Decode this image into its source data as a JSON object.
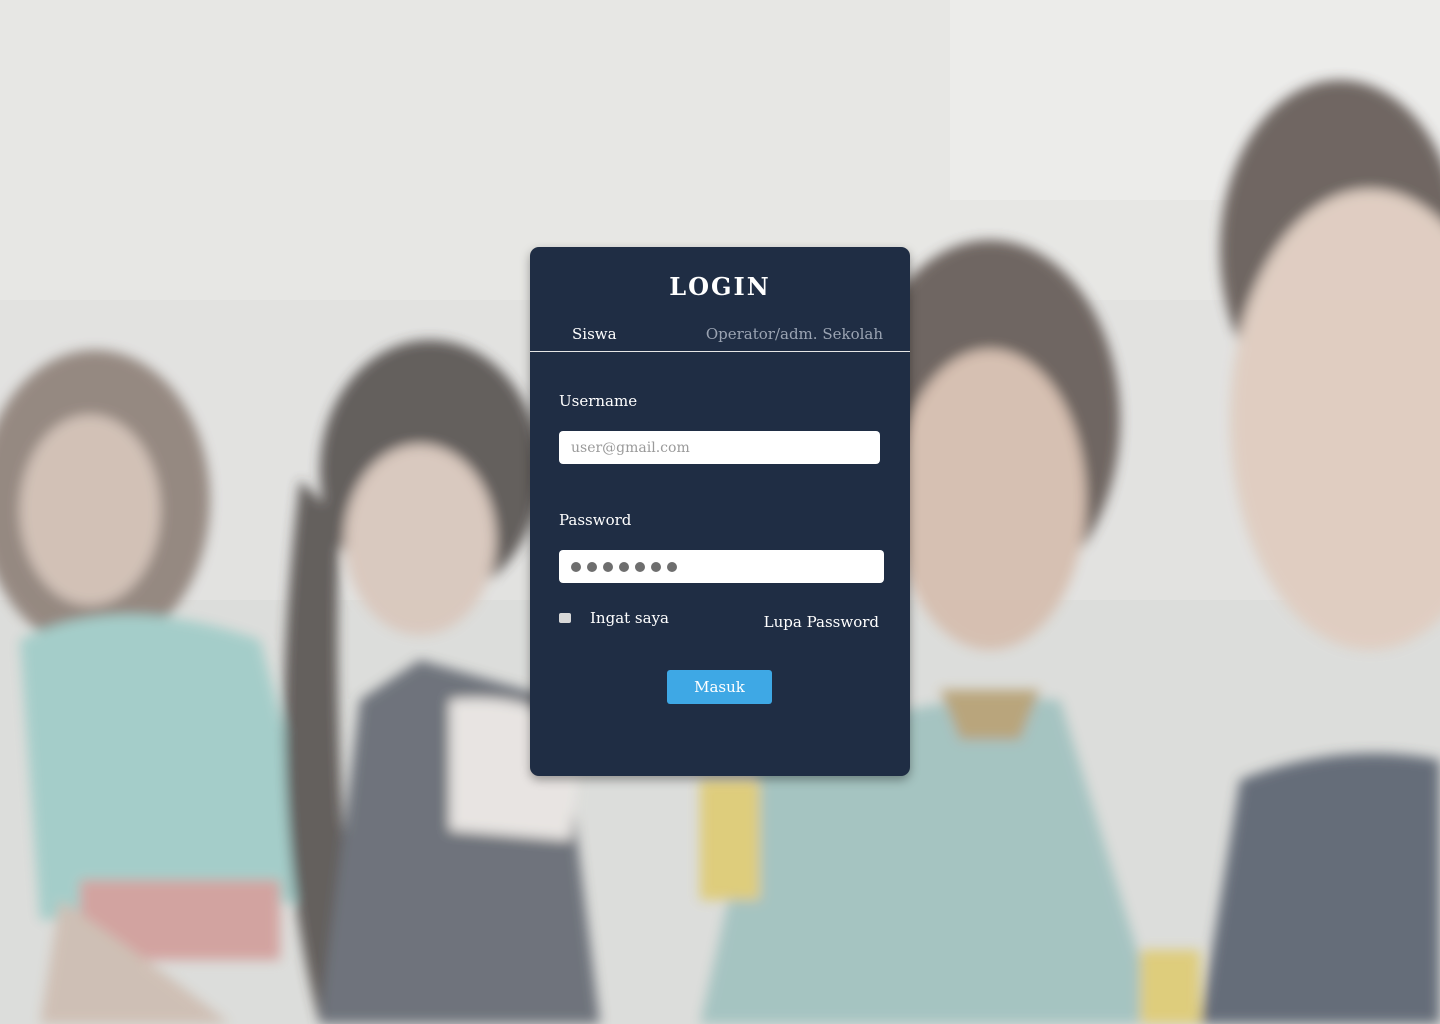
{
  "page": {
    "title": "LOGIN"
  },
  "tabs": [
    {
      "label": "Siswa",
      "active": true
    },
    {
      "label": "Operator/adm. Sekolah",
      "active": false
    }
  ],
  "form": {
    "username_label": "Username",
    "username_placeholder": "user@gmail.com",
    "username_value": "",
    "password_label": "Password",
    "password_masked_length": 7,
    "remember_label": "Ingat saya",
    "remember_checked": false,
    "forgot_label": "Lupa Password",
    "submit_label": "Masuk"
  },
  "colors": {
    "card_bg": "#1f2d44",
    "submit_bg": "#3ea8e5",
    "inactive_tab": "#9aa3b2"
  }
}
